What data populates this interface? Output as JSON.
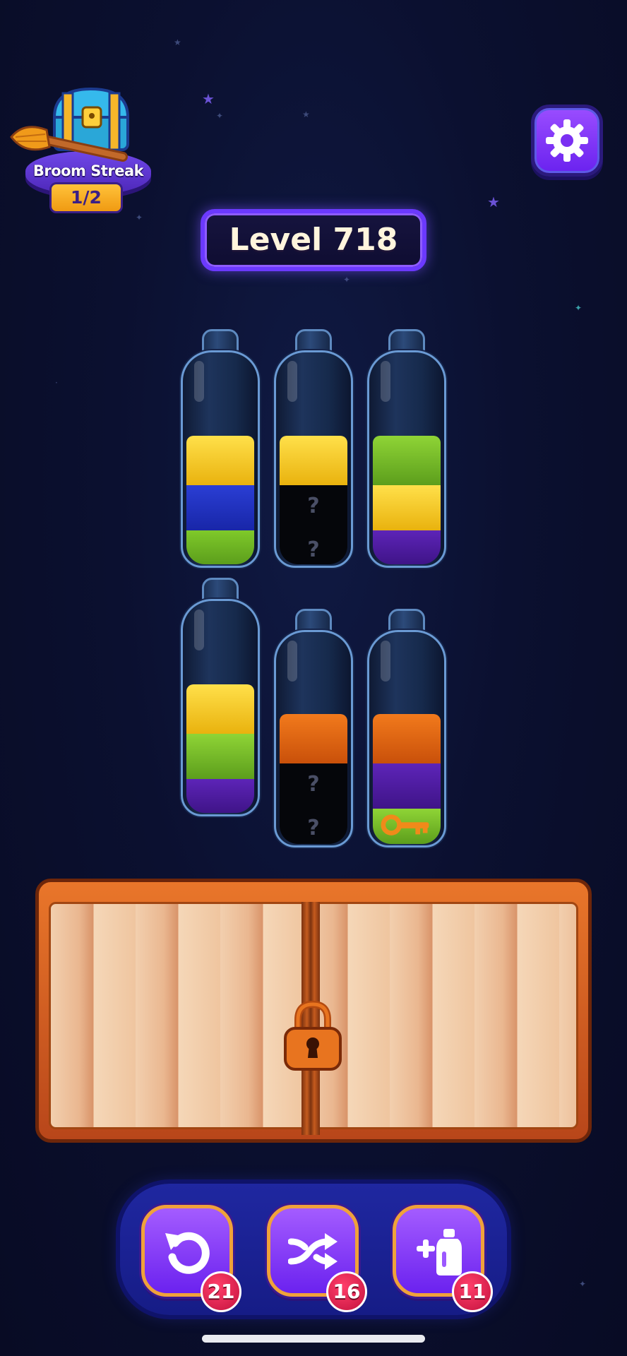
{
  "broom_streak": {
    "label": "Broom Streak",
    "progress_text": "1/2",
    "icon": "treasure-chest-with-broom"
  },
  "settings": {
    "icon": "gear-icon"
  },
  "level": {
    "text": "Level 718"
  },
  "colors": {
    "yellow": "#f4c31c",
    "blue": "#1c2fb8",
    "green": "#6cb323",
    "purple": "#4f1da6",
    "orange": "#e0620e",
    "hidden": "#05060a",
    "accent": "#6b39ff"
  },
  "bottles": [
    {
      "id": "bottle-1",
      "layers_top_to_bottom": [
        "yellow",
        "blue",
        "green"
      ],
      "hidden_count": 0
    },
    {
      "id": "bottle-2",
      "layers_top_to_bottom": [
        "yellow",
        "hidden",
        "hidden"
      ],
      "hidden_mark": "?"
    },
    {
      "id": "bottle-3",
      "layers_top_to_bottom": [
        "green",
        "yellow",
        "purple"
      ]
    },
    {
      "id": "bottle-4",
      "layers_top_to_bottom": [
        "yellow",
        "green",
        "purple"
      ]
    },
    {
      "id": "bottle-5",
      "layers_top_to_bottom": [
        "orange",
        "hidden",
        "hidden"
      ],
      "hidden_mark": "?"
    },
    {
      "id": "bottle-6",
      "layers_top_to_bottom": [
        "orange",
        "purple",
        "green"
      ],
      "bottom_item": "key-icon"
    }
  ],
  "locked_box": {
    "icon": "padlock-icon",
    "state": "locked"
  },
  "powerups": [
    {
      "name": "undo",
      "icon": "undo-icon",
      "count": "21"
    },
    {
      "name": "shuffle",
      "icon": "shuffle-icon",
      "count": "16"
    },
    {
      "name": "add-bottle",
      "icon": "add-bottle-icon",
      "count": "11"
    }
  ]
}
